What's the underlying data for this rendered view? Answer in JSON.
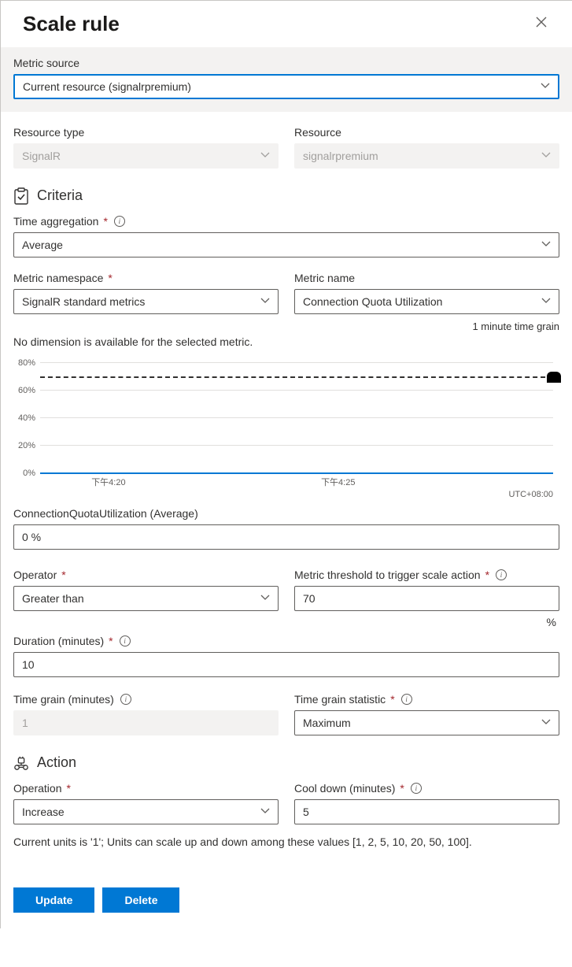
{
  "header": {
    "title": "Scale rule"
  },
  "metric_source": {
    "label": "Metric source",
    "value": "Current resource (signalrpremium)"
  },
  "resource_type": {
    "label": "Resource type",
    "value": "SignalR"
  },
  "resource": {
    "label": "Resource",
    "value": "signalrpremium"
  },
  "criteria": {
    "title": "Criteria",
    "time_aggregation": {
      "label": "Time aggregation",
      "value": "Average"
    },
    "metric_namespace": {
      "label": "Metric namespace",
      "value": "SignalR standard metrics"
    },
    "metric_name": {
      "label": "Metric name",
      "value": "Connection Quota Utilization"
    },
    "grain_note": "1 minute time grain",
    "no_dimension": "No dimension is available for the selected metric.",
    "chart_caption": "ConnectionQuotaUtilization (Average)",
    "current_value": "0 %",
    "operator": {
      "label": "Operator",
      "value": "Greater than"
    },
    "threshold": {
      "label": "Metric threshold to trigger scale action",
      "value": "70",
      "unit": "%"
    },
    "duration": {
      "label": "Duration (minutes)",
      "value": "10"
    },
    "time_grain": {
      "label": "Time grain (minutes)",
      "value": "1"
    },
    "time_grain_stat": {
      "label": "Time grain statistic",
      "value": "Maximum"
    }
  },
  "action": {
    "title": "Action",
    "operation": {
      "label": "Operation",
      "value": "Increase"
    },
    "cooldown": {
      "label": "Cool down (minutes)",
      "value": "5"
    },
    "footnote": "Current units is '1'; Units can scale up and down among these values [1, 2, 5, 10, 20, 50, 100]."
  },
  "buttons": {
    "update": "Update",
    "delete": "Delete"
  },
  "chart_data": {
    "type": "line",
    "title": "ConnectionQuotaUtilization (Average)",
    "ylabel": "%",
    "ylim": [
      0,
      80
    ],
    "yticks": [
      "0%",
      "20%",
      "40%",
      "60%",
      "80%"
    ],
    "threshold": 70,
    "x_ticks": [
      "下午4:20",
      "下午4:25"
    ],
    "timezone": "UTC+08:00",
    "series": [
      {
        "name": "ConnectionQuotaUtilization",
        "values": [
          0,
          0,
          0,
          0,
          0,
          0,
          0,
          0,
          0,
          0
        ]
      }
    ]
  }
}
